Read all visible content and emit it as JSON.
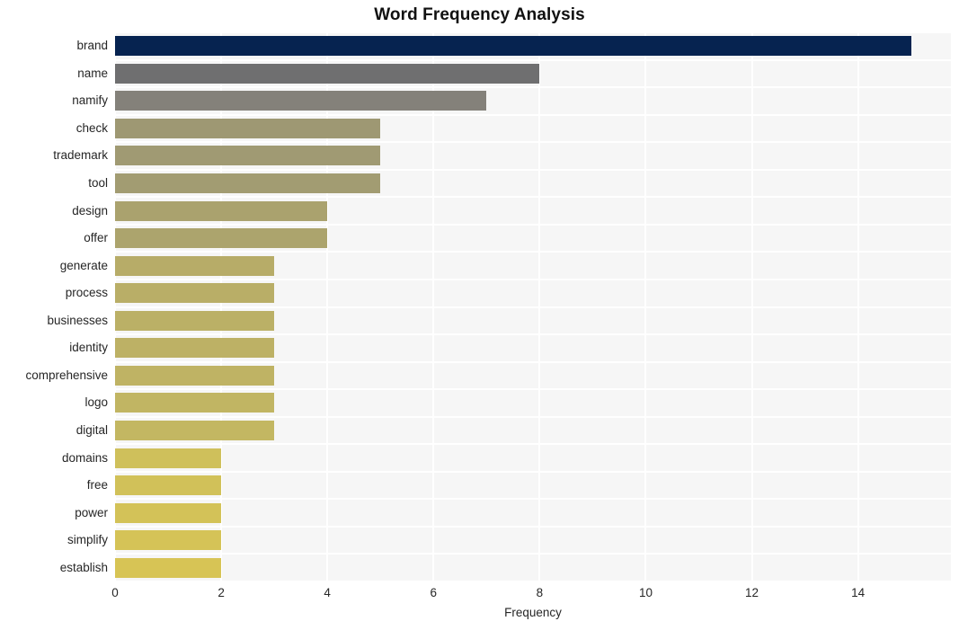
{
  "chart_data": {
    "type": "bar",
    "orientation": "horizontal",
    "title": "Word Frequency Analysis",
    "xlabel": "Frequency",
    "ylabel": "",
    "categories": [
      "brand",
      "name",
      "namify",
      "check",
      "trademark",
      "tool",
      "design",
      "offer",
      "generate",
      "process",
      "businesses",
      "identity",
      "comprehensive",
      "logo",
      "digital",
      "domains",
      "free",
      "power",
      "simplify",
      "establish"
    ],
    "values": [
      15,
      8,
      7,
      5,
      5,
      5,
      4,
      4,
      3,
      3,
      3,
      3,
      3,
      3,
      3,
      2,
      2,
      2,
      2,
      2
    ],
    "bar_colors": [
      "#062350",
      "#6f6f70",
      "#84817a",
      "#9e9873",
      "#a09a73",
      "#a29c72",
      "#aaa26e",
      "#aca46d",
      "#b7ac68",
      "#b9ae67",
      "#bbb066",
      "#bdb165",
      "#bfb364",
      "#c1b563",
      "#c3b762",
      "#cfc05b",
      "#d1c159",
      "#d3c258",
      "#d5c357",
      "#d7c455"
    ],
    "x": [
      0,
      2,
      4,
      6,
      8,
      10,
      12,
      14
    ],
    "xtick_labels": [
      "0",
      "2",
      "4",
      "6",
      "8",
      "10",
      "12",
      "14"
    ],
    "xlim": [
      0,
      15.75
    ],
    "grid": true,
    "legend": null,
    "plot_bg": "#f6f6f6",
    "grid_color": "#ffffff",
    "points": [
      {
        "word": "brand",
        "frequency": 15
      },
      {
        "word": "name",
        "frequency": 8
      },
      {
        "word": "namify",
        "frequency": 7
      },
      {
        "word": "check",
        "frequency": 5
      },
      {
        "word": "trademark",
        "frequency": 5
      },
      {
        "word": "tool",
        "frequency": 5
      },
      {
        "word": "design",
        "frequency": 4
      },
      {
        "word": "offer",
        "frequency": 4
      },
      {
        "word": "generate",
        "frequency": 3
      },
      {
        "word": "process",
        "frequency": 3
      },
      {
        "word": "businesses",
        "frequency": 3
      },
      {
        "word": "identity",
        "frequency": 3
      },
      {
        "word": "comprehensive",
        "frequency": 3
      },
      {
        "word": "logo",
        "frequency": 3
      },
      {
        "word": "digital",
        "frequency": 3
      },
      {
        "word": "domains",
        "frequency": 2
      },
      {
        "word": "free",
        "frequency": 2
      },
      {
        "word": "power",
        "frequency": 2
      },
      {
        "word": "simplify",
        "frequency": 2
      },
      {
        "word": "establish",
        "frequency": 2
      }
    ]
  }
}
